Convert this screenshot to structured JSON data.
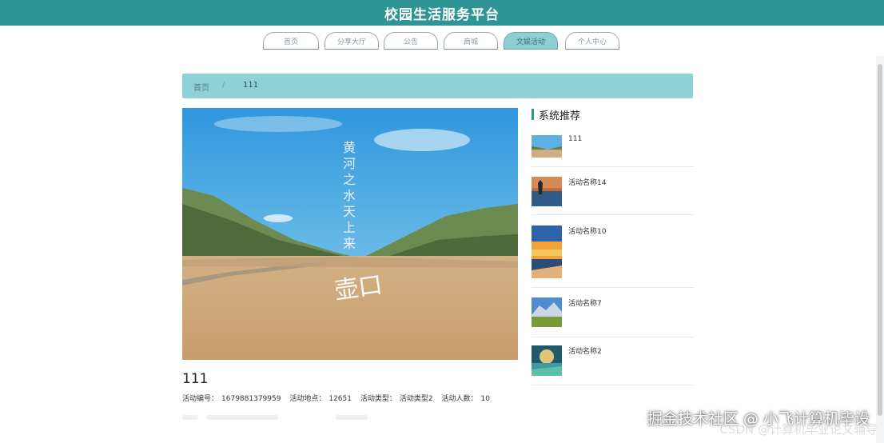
{
  "app": {
    "title": "校园生活服务平台"
  },
  "nav": {
    "tabs": [
      {
        "label": "首页",
        "active": false
      },
      {
        "label": "分享大厅",
        "active": false
      },
      {
        "label": "公告",
        "active": false
      },
      {
        "label": "商城",
        "active": false
      },
      {
        "label": "文娱活动",
        "active": true
      },
      {
        "label": "个人中心",
        "active": false
      }
    ]
  },
  "breadcrumb": {
    "home": "首页",
    "separator": "/",
    "current": "111"
  },
  "hero": {
    "calligraphy_vertical": "黄河之水天上来",
    "calligraphy_sign": "壶口"
  },
  "activity": {
    "title": "111",
    "fields": [
      {
        "label": "活动编号：",
        "value": "1679881379959"
      },
      {
        "label": "活动地点：",
        "value": "12651"
      },
      {
        "label": "活动类型：",
        "value": "活动类型2"
      },
      {
        "label": "活动人数：",
        "value": "10"
      }
    ]
  },
  "sidebar": {
    "title": "系统推荐",
    "items": [
      {
        "name": "111",
        "thumb": "river-desert-icon"
      },
      {
        "name": "活动名称14",
        "thumb": "lake-sunset-icon"
      },
      {
        "name": "活动名称10",
        "thumb": "beach-sunset-icon"
      },
      {
        "name": "活动名称7",
        "thumb": "mountain-meadow-icon"
      },
      {
        "name": "活动名称2",
        "thumb": "waterfall-sunrise-icon"
      }
    ]
  },
  "watermark": {
    "main": "掘金技术社区 @ 小飞计算机毕设",
    "sub": "CSDN @计算机毕业论文辅导"
  },
  "colors": {
    "brand": "#2e9594",
    "accent_light": "#8ed1d6"
  }
}
